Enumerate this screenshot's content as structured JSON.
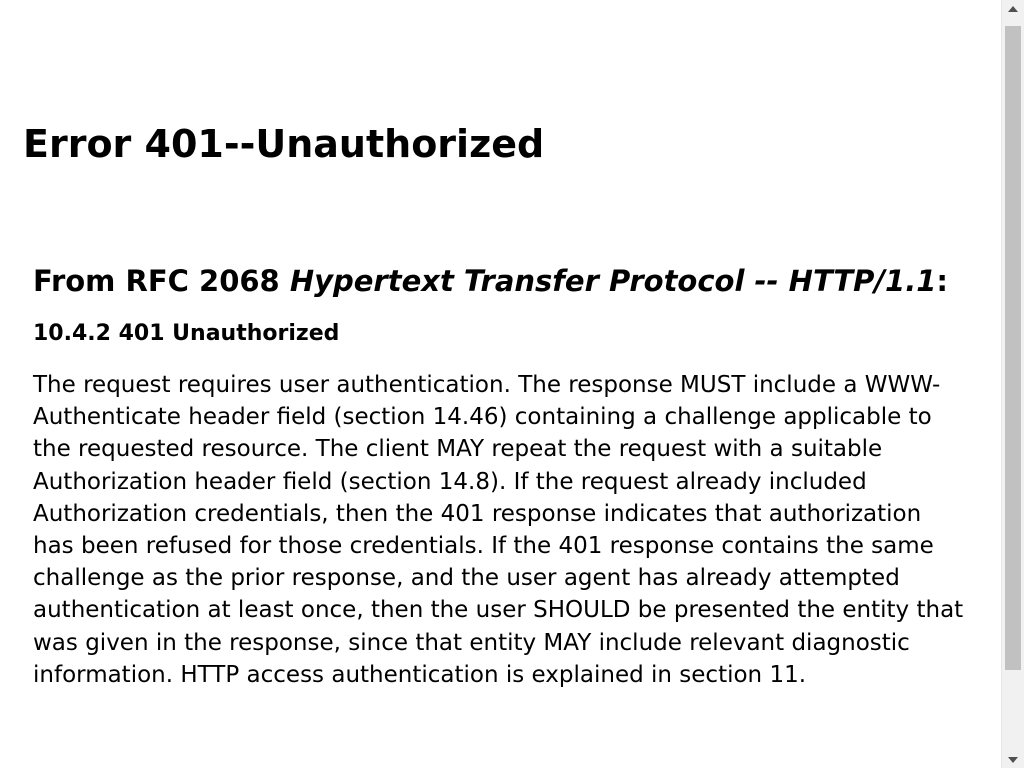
{
  "page": {
    "error_title": "Error 401--Unauthorized",
    "rfc_heading": {
      "prefix": "From RFC 2068 ",
      "italic": "Hypertext Transfer Protocol -- HTTP/1.1",
      "suffix": ":"
    },
    "section_heading": "10.4.2 401 Unauthorized",
    "body_text": "The request requires user authentication. The response MUST include a WWW-Authenticate header field (section 14.46) containing a challenge applicable to the requested resource. The client MAY repeat the request with a suitable Authorization header field (section 14.8). If the request already included Authorization credentials, then the 401 response indicates that authorization has been refused for those credentials. If the 401 response contains the same challenge as the prior response, and the user agent has already attempted authentication at least once, then the user SHOULD be presented the entity that was given in the response, since that entity MAY include relevant diagnostic information. HTTP access authentication is explained in section 11."
  },
  "scrollbar": {
    "up_icon": "triangle-up",
    "down_icon": "triangle-down"
  }
}
